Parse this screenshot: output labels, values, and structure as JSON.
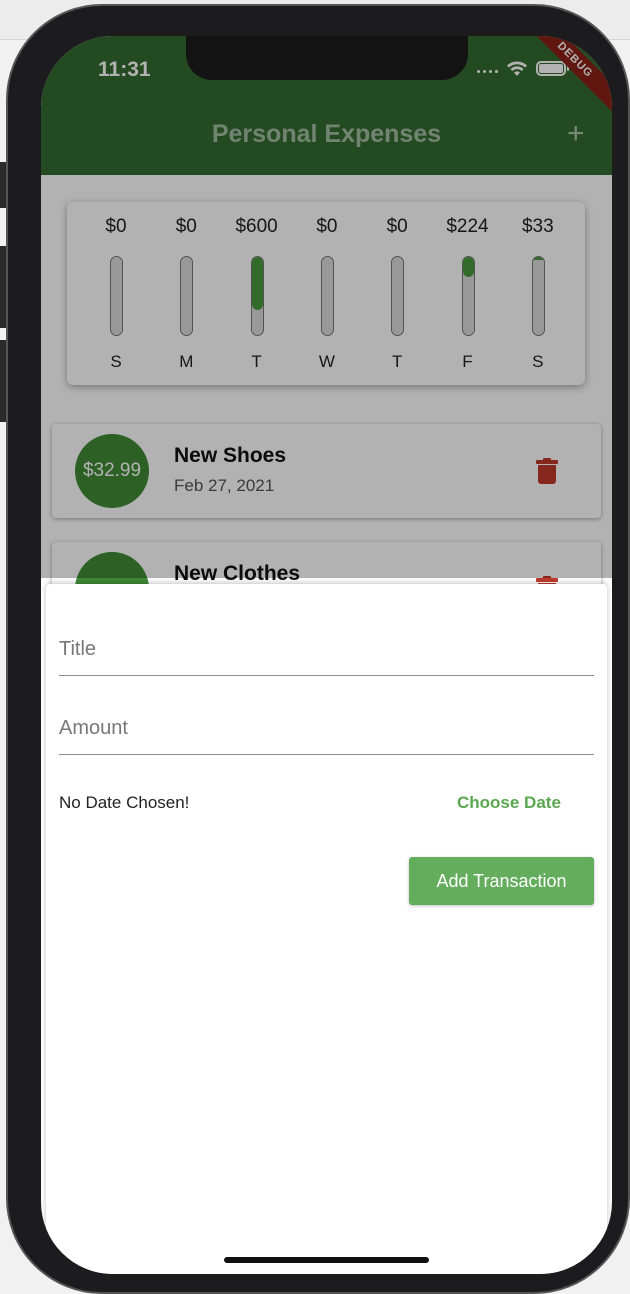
{
  "status_bar": {
    "time": "11:31"
  },
  "debug_banner": "DEBUG",
  "appbar": {
    "title": "Personal Expenses",
    "add_icon": "+"
  },
  "chart_data": {
    "type": "bar",
    "categories": [
      "S",
      "M",
      "T",
      "W",
      "T",
      "F",
      "S"
    ],
    "labels": [
      "$0",
      "$0",
      "$600",
      "$0",
      "$0",
      "$224",
      "$33"
    ],
    "values": [
      0,
      0,
      600,
      0,
      0,
      224,
      33
    ],
    "fractions": [
      0,
      0,
      0.6807,
      0,
      0,
      0.2541,
      0.0374
    ],
    "bar_color": "#4a9a3e"
  },
  "chart": {
    "bars": [
      {
        "amount": "$0",
        "day": "S",
        "fraction": 0
      },
      {
        "amount": "$0",
        "day": "M",
        "fraction": 0
      },
      {
        "amount": "$600",
        "day": "T",
        "fraction": 0.6807
      },
      {
        "amount": "$0",
        "day": "W",
        "fraction": 0
      },
      {
        "amount": "$0",
        "day": "T",
        "fraction": 0
      },
      {
        "amount": "$224",
        "day": "F",
        "fraction": 0.2541
      },
      {
        "amount": "$33",
        "day": "S",
        "fraction": 0.0374
      }
    ]
  },
  "transactions": [
    {
      "amount": "$32.99",
      "title": "New Shoes",
      "date": "Feb 27, 2021"
    },
    {
      "amount": "",
      "title": "New Clothes",
      "date": ""
    }
  ],
  "sheet": {
    "title_placeholder": "Title",
    "amount_placeholder": "Amount",
    "date_label": "No Date Chosen!",
    "choose_date": "Choose Date",
    "add_button": "Add Transaction"
  },
  "colors": {
    "primary": "#346b31",
    "accent": "#5aa850",
    "button": "#63ad5c",
    "delete": "#c0392b"
  }
}
